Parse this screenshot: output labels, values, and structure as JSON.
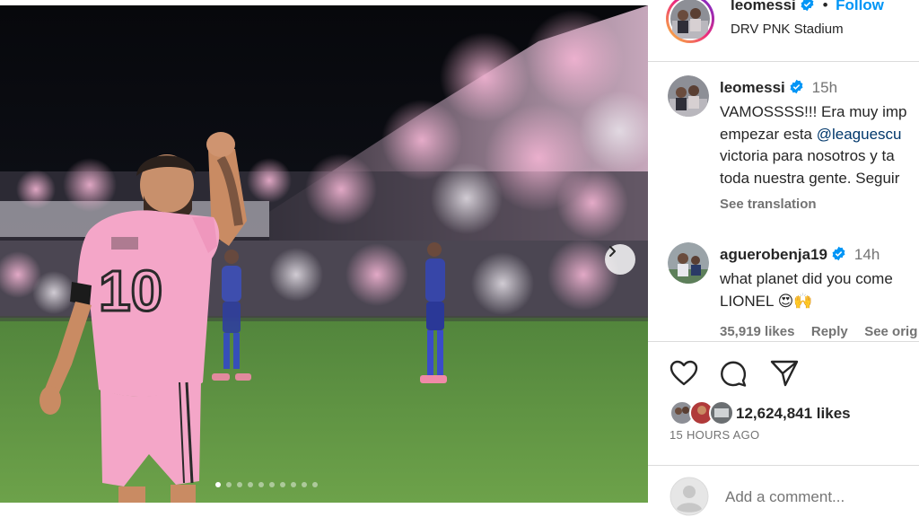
{
  "post": {
    "author": "leomessi",
    "follow_label": "Follow",
    "separator": "•",
    "location": "DRV PNK Stadium",
    "media": {
      "carousel_count": 10,
      "active_index": 0,
      "jersey_number": "10"
    }
  },
  "caption": {
    "author": "leomessi",
    "time": "15h",
    "lines": [
      "VAMOSSSS!!! Era muy imp",
      "empezar esta ",
      "victoria para nosotros y ta",
      "toda nuestra gente. Seguir"
    ],
    "mention": "@leaguescu",
    "see_translation": "See translation"
  },
  "comment": {
    "author": "aguerobenja19",
    "time": "14h",
    "line1": "what planet did you come",
    "line2": "LIONEL",
    "emoji": "😍🙌",
    "likes": "35,919 likes",
    "reply": "Reply",
    "see_original": "See orig"
  },
  "actions": {
    "likes_count": "12,624,841 likes",
    "time_ago": "15 HOURS AGO"
  },
  "add_comment": {
    "placeholder": "Add a comment..."
  },
  "colors": {
    "link_blue": "#0095f6",
    "mention_blue": "#00376b",
    "verified_blue": "#0095f6",
    "muted_gray": "#737373",
    "jersey_pink": "#f4a6c8"
  },
  "icons": [
    "verified-icon",
    "heart-icon",
    "comment-icon",
    "share-icon",
    "chevron-right-icon",
    "default-avatar-icon"
  ]
}
